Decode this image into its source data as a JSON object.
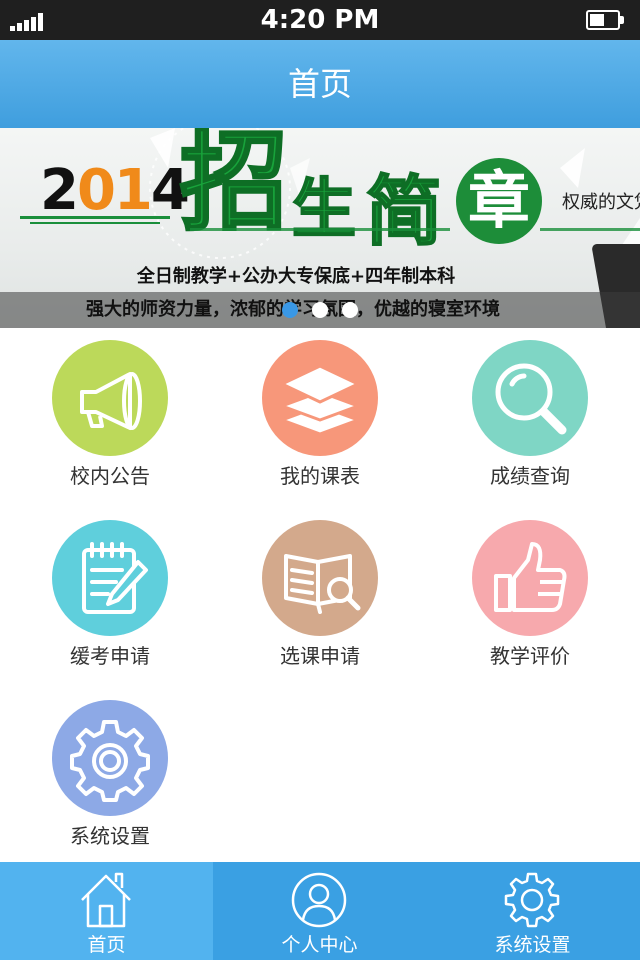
{
  "status_bar": {
    "time": "4:20 PM"
  },
  "nav": {
    "title": "首页"
  },
  "banner": {
    "year_prefix": "2",
    "year_accent": "01",
    "year_suffix": "4",
    "headline_1": "招",
    "headline_2": "生",
    "headline_3": "简",
    "headline_4": "章",
    "side_text": "权威的文凭",
    "subtitle": "全日制教学+公办大专保底+四年制本科",
    "caption": "强大的师资力量，浓郁的学习氛围，优越的寝室环境",
    "slide_count": 3,
    "active_slide": 0
  },
  "grid": {
    "items": [
      {
        "label": "校内公告",
        "color": "#bcd95a",
        "icon": "megaphone-icon"
      },
      {
        "label": "我的课表",
        "color": "#f7977a",
        "icon": "layers-icon"
      },
      {
        "label": "成绩查询",
        "color": "#7fd6c5",
        "icon": "search-icon"
      },
      {
        "label": "缓考申请",
        "color": "#5fcfdc",
        "icon": "notepad-pencil-icon"
      },
      {
        "label": "选课申请",
        "color": "#d3a98c",
        "icon": "book-search-icon"
      },
      {
        "label": "教学评价",
        "color": "#f7a9ad",
        "icon": "thumbs-up-icon"
      },
      {
        "label": "系统设置",
        "color": "#8da9e6",
        "icon": "gear-icon"
      }
    ]
  },
  "tabbar": {
    "tabs": [
      {
        "label": "首页",
        "icon": "home-icon",
        "active": true
      },
      {
        "label": "个人中心",
        "icon": "user-icon",
        "active": false
      },
      {
        "label": "系统设置",
        "icon": "gear-icon",
        "active": false
      }
    ]
  },
  "colors": {
    "nav_blue": "#4aa8e8",
    "tab_blue": "#3aa0e3",
    "tab_active": "#52b3ef",
    "dot_active": "#3a98e6"
  }
}
